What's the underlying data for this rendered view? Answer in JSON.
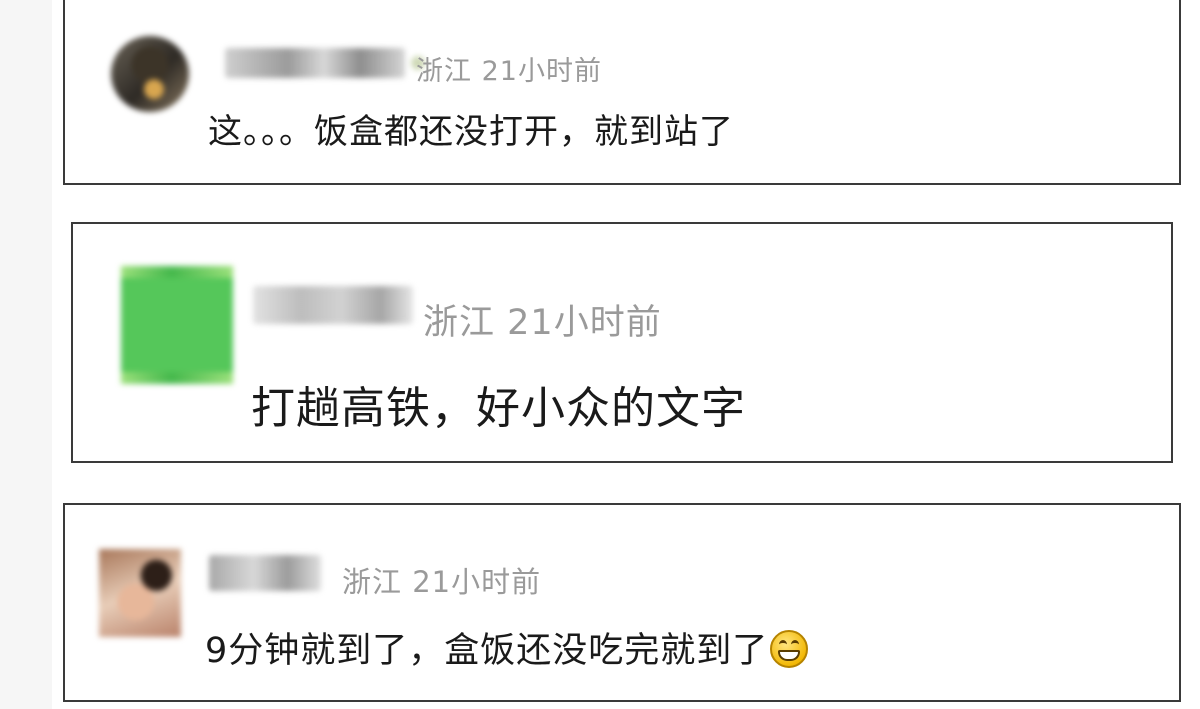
{
  "comments": [
    {
      "location": "浙江",
      "time": "21小时前",
      "text": "这。。。饭盒都还没打开，就到站了"
    },
    {
      "location": "浙江",
      "time": "21小时前",
      "text": "打趟高铁，好小众的文字"
    },
    {
      "location": "浙江",
      "time": "21小时前",
      "text": "9分钟就到了，盒饭还没吃完就到了",
      "emoji": "grinning-face-icon"
    }
  ],
  "colors": {
    "meta_text": "#9a9a9a",
    "comment_text": "#1a1a1a",
    "card_border": "#3a3a3a"
  }
}
